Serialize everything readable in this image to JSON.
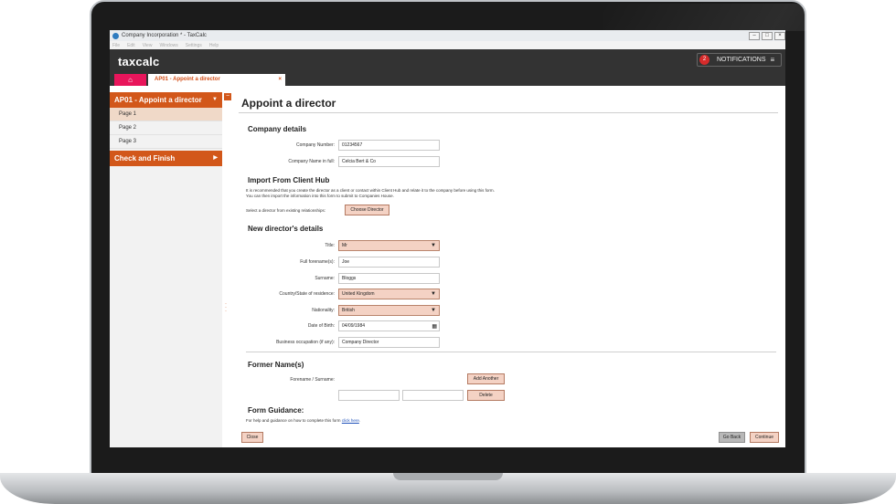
{
  "window": {
    "title": "Company Incorporation * - TaxCalc"
  },
  "menu": [
    "File",
    "Edit",
    "View",
    "Windows",
    "Settings",
    "Help"
  ],
  "header": {
    "logo": "taxcalc",
    "notifications": {
      "count": "2",
      "label": "NOTIFICATIONS"
    }
  },
  "tabs": {
    "home_icon": "home-icon",
    "document": "AP01 - Appoint a director",
    "close": "×"
  },
  "sidebar": {
    "form": "AP01 - Appoint a director",
    "pages": [
      "Page 1",
      "Page 2",
      "Page 3"
    ],
    "check": "Check and Finish"
  },
  "main": {
    "title": "Appoint a director",
    "company": {
      "heading": "Company details",
      "number_label": "Company Number:",
      "number": "01234567",
      "name_label": "Company Name in full:",
      "name": "Celcia Bert & Co"
    },
    "import": {
      "heading": "Import From Client Hub",
      "note1": "It is recommended that you create the director as a client or contact within Client Hub and relate it to the company before using this form.",
      "note2": "You can then import the information into this form to submit to Companies House.",
      "select_label": "Select a director from existing relationships:",
      "button": "Choose Director"
    },
    "director": {
      "heading": "New director's details",
      "title_label": "Title:",
      "title": "Mr",
      "forename_label": "Full forename(s):",
      "forename": "Joe",
      "surname_label": "Surname:",
      "surname": "Bloggs",
      "country_label": "Country/State of residence:",
      "country": "United Kingdom",
      "nationality_label": "Nationality:",
      "nationality": "British",
      "dob_label": "Date of Birth:",
      "dob": "04/09/1984",
      "occupation_label": "Business occupation (if any):",
      "occupation": "Company Director"
    },
    "former": {
      "heading": "Former Name(s)",
      "label": "Forename / Surname:",
      "add": "Add Another",
      "delete": "Delete"
    },
    "guidance": {
      "heading": "Form Guidance:",
      "text": "For help and guidance on how to complete this form",
      "link": "click here",
      "end": "."
    },
    "footer": {
      "close": "Close",
      "back": "Go Back",
      "continue": "Continue"
    }
  },
  "colors": {
    "accent": "#d2571a",
    "pink": "#e8155b",
    "header": "#333333"
  }
}
